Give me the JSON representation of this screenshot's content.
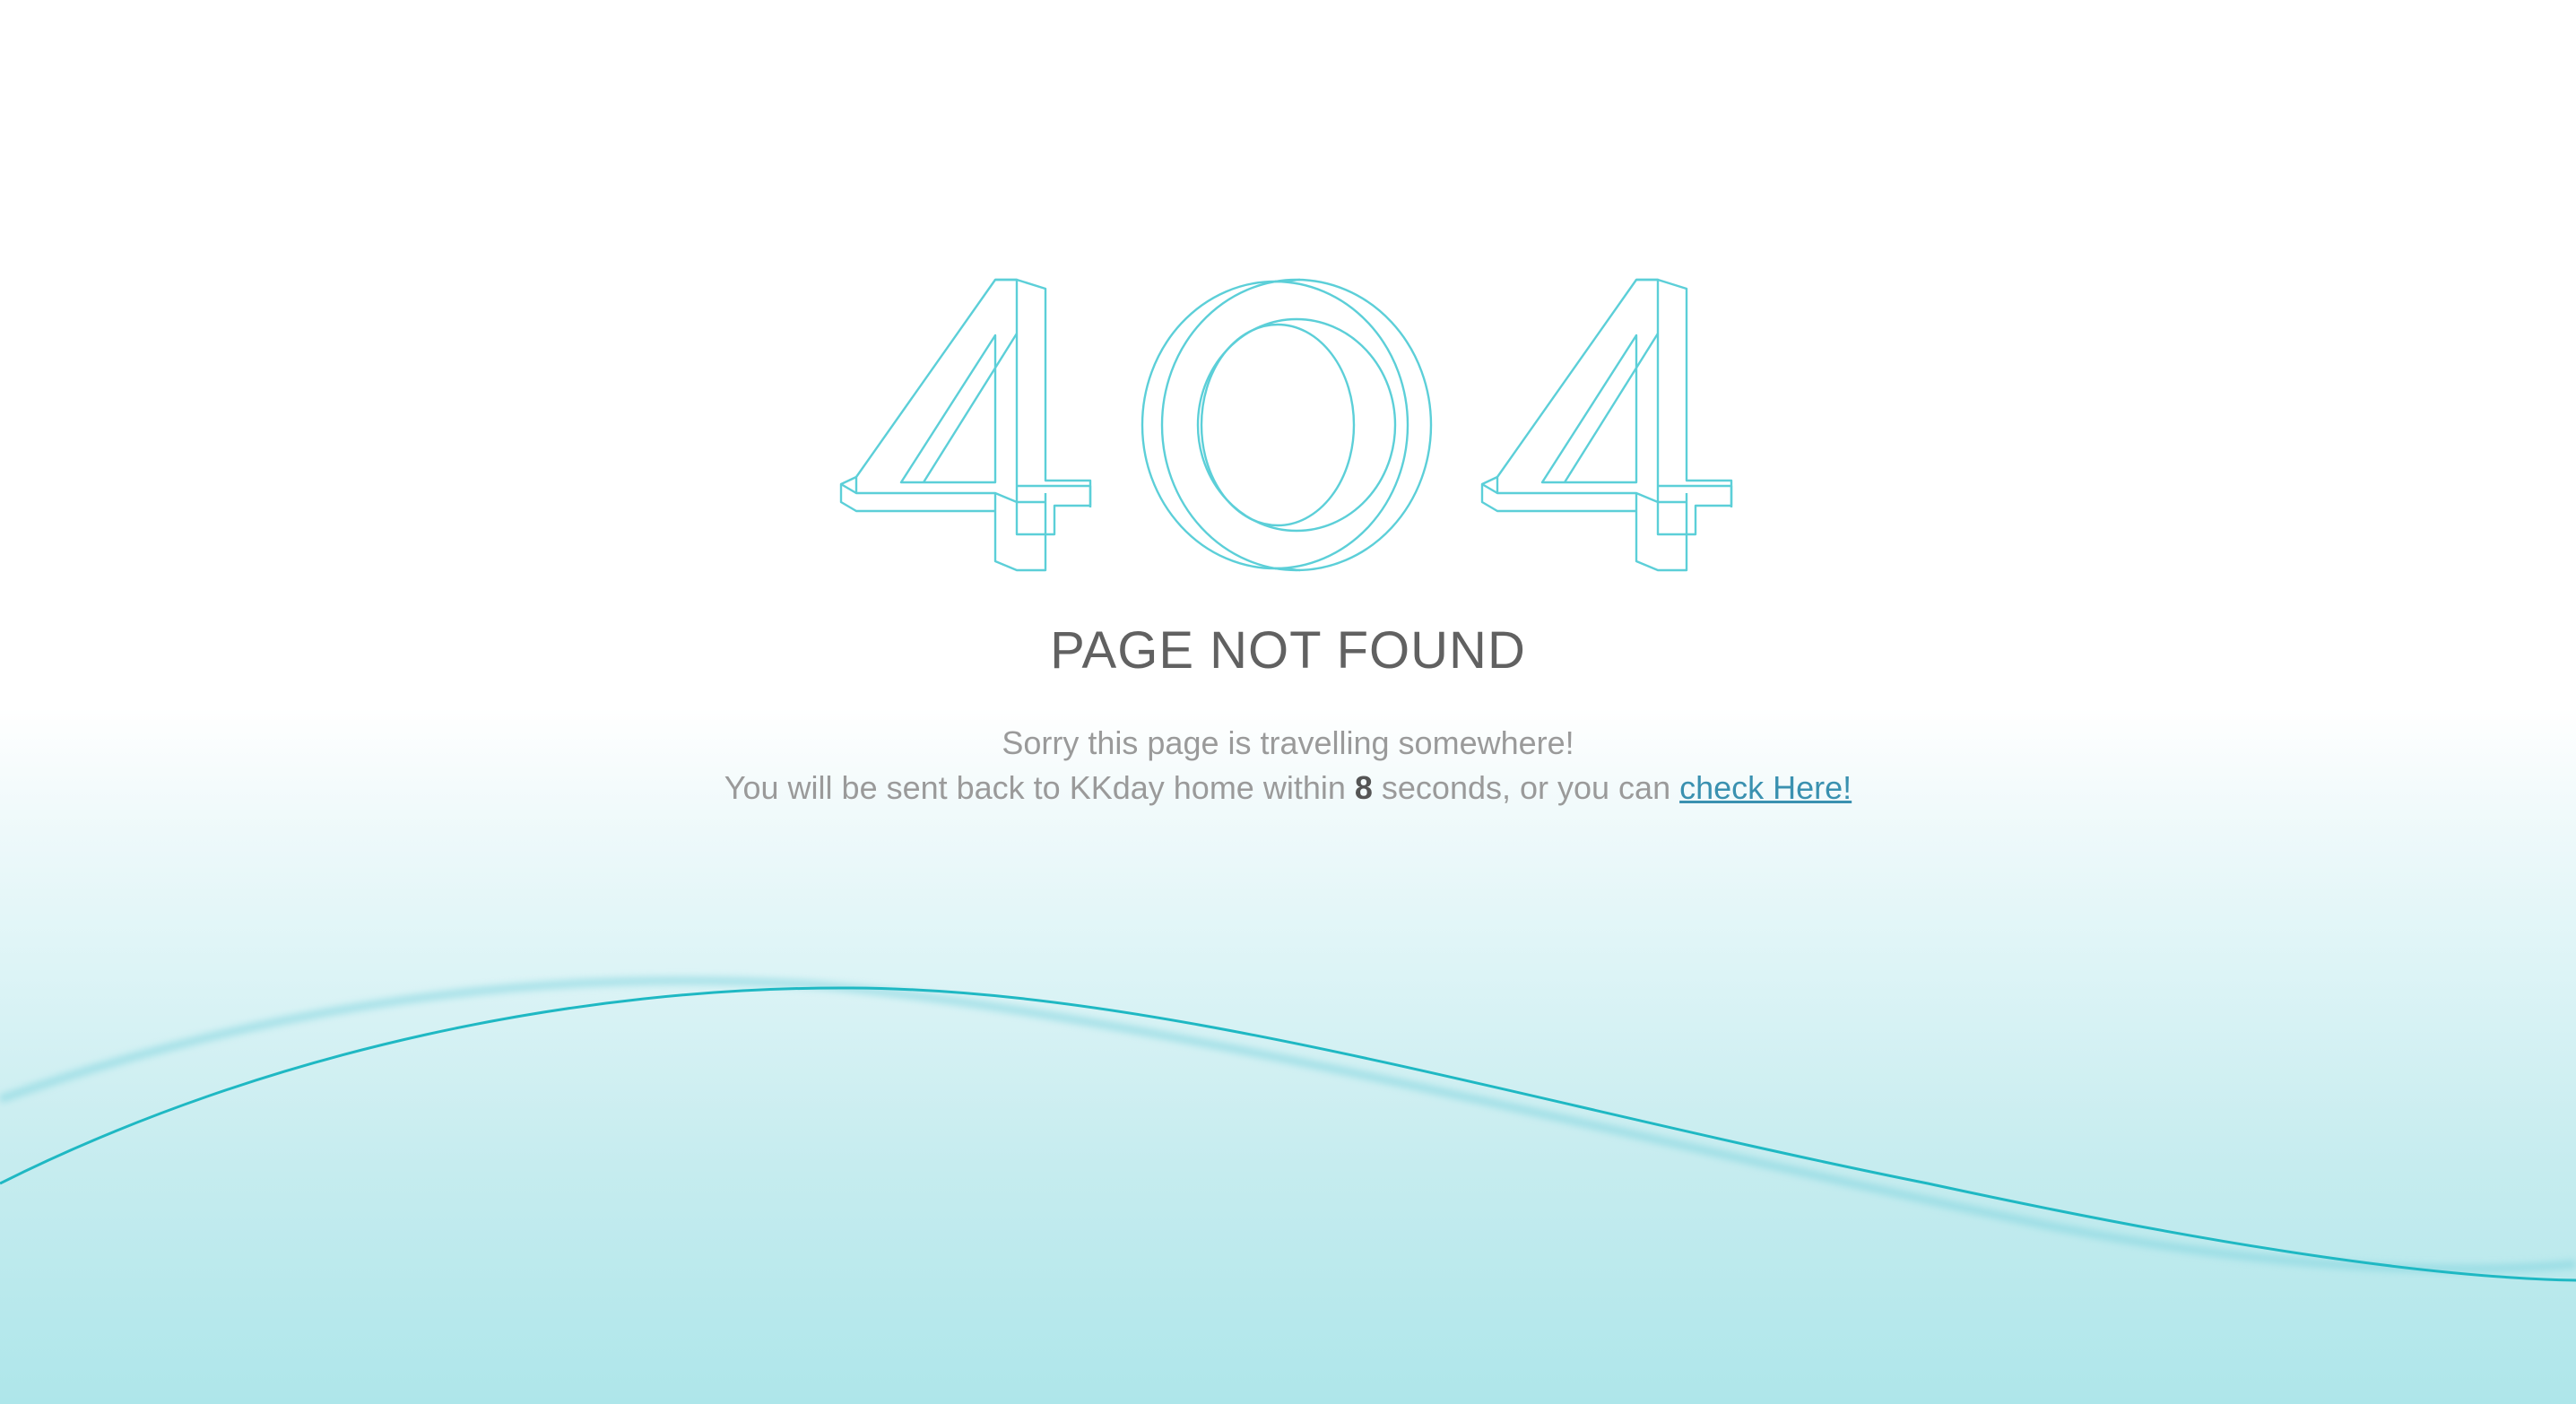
{
  "hero": {
    "code": "404",
    "accent_color": "#5ccfd8",
    "digits": [
      "4",
      "0",
      "4"
    ]
  },
  "title": "PAGE NOT FOUND",
  "message": {
    "line1": "Sorry this page is travelling somewhere!",
    "line2_prefix": "You will be sent back to KKday home within ",
    "countdown": "8",
    "line2_middle": " seconds, or you can ",
    "link_text": "check Here!"
  },
  "colors": {
    "title": "#616161",
    "text": "#9a9a9a",
    "link": "#3a91b0",
    "wave": "#1fb8c3",
    "background_bottom": "#aee6ea"
  }
}
